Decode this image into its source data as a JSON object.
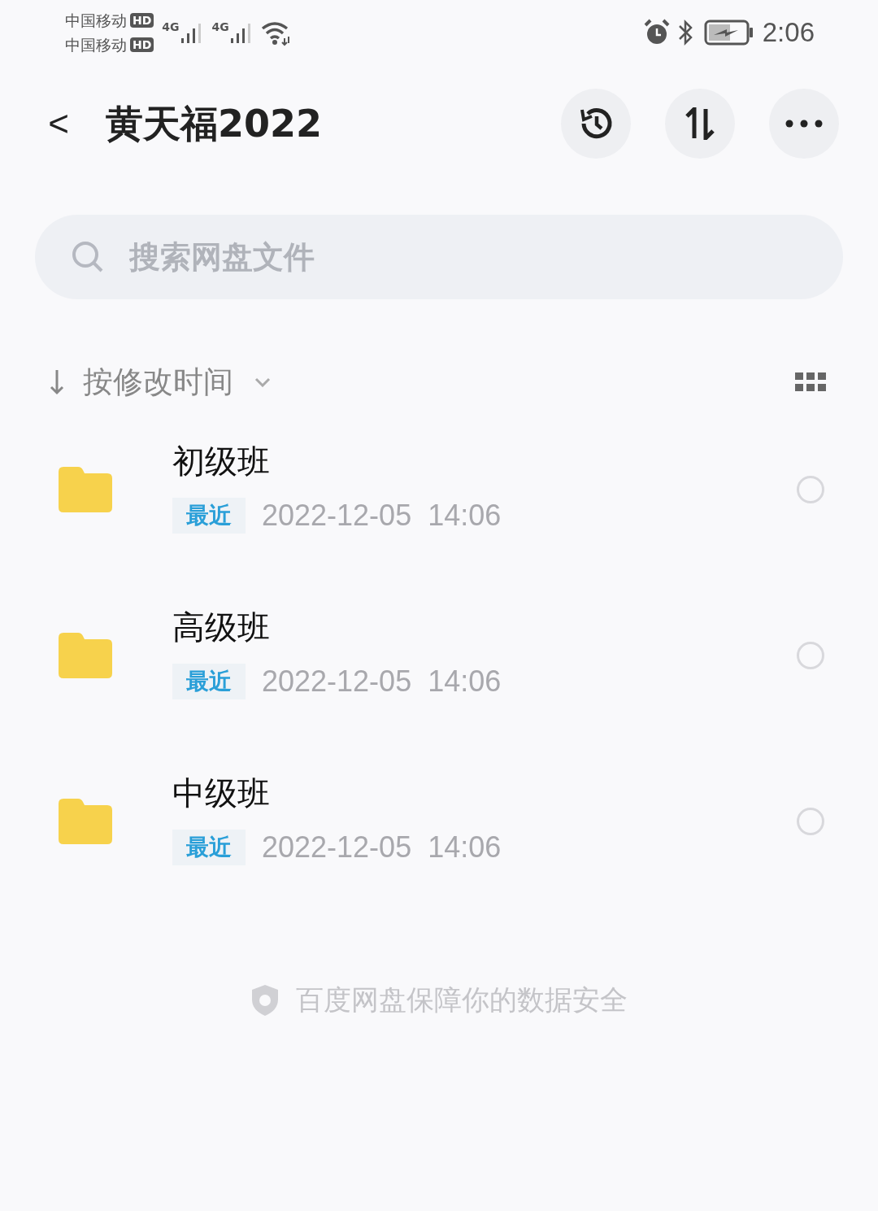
{
  "status_bar": {
    "carriers": [
      {
        "name": "中国移动",
        "badge": "HD"
      },
      {
        "name": "中国移动",
        "badge": "HD"
      }
    ],
    "networks": [
      "4G",
      "4G"
    ],
    "time": "2:06"
  },
  "header": {
    "back": "<",
    "title": "黄天福2022"
  },
  "search": {
    "placeholder": "搜索网盘文件"
  },
  "sort": {
    "label": "按修改时间"
  },
  "files": [
    {
      "name": "初级班",
      "tag": "最近",
      "modified": "2022-12-05  14:06",
      "selected": false
    },
    {
      "name": "高级班",
      "tag": "最近",
      "modified": "2022-12-05  14:06",
      "selected": false
    },
    {
      "name": "中级班",
      "tag": "最近",
      "modified": "2022-12-05  14:06",
      "selected": false
    }
  ],
  "footer": {
    "note": "百度网盘保障你的数据安全"
  }
}
